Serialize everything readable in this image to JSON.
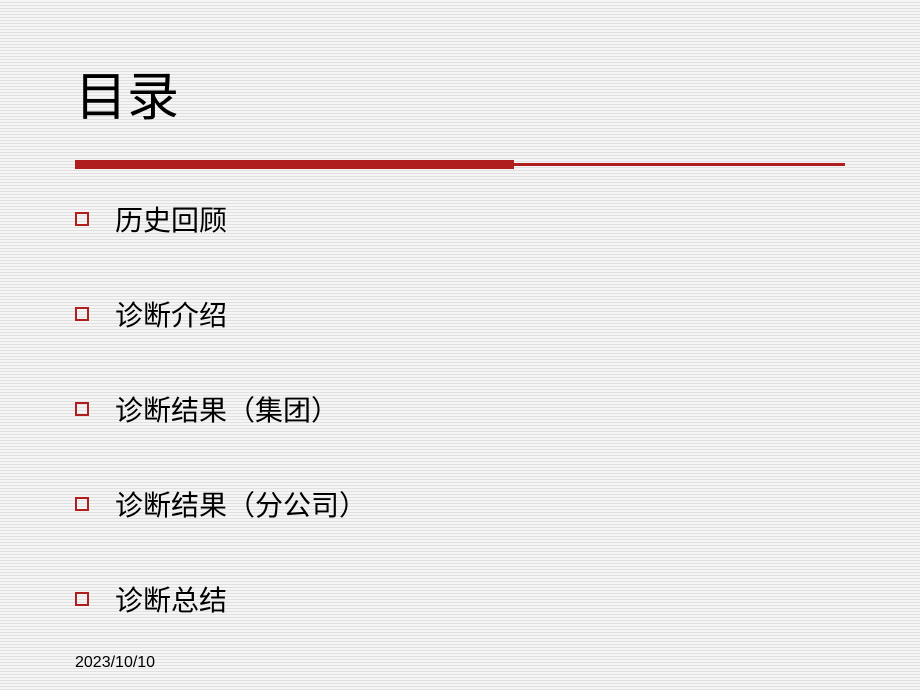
{
  "title": "目录",
  "toc": {
    "items": [
      {
        "label": "历史回顾"
      },
      {
        "label": "诊断介绍"
      },
      {
        "label": "诊断结果（集团）"
      },
      {
        "label": "诊断结果（分公司）"
      },
      {
        "label": "诊断总结"
      }
    ]
  },
  "footer": {
    "date": "2023/10/10"
  },
  "colors": {
    "accent": "#b01e1e"
  }
}
